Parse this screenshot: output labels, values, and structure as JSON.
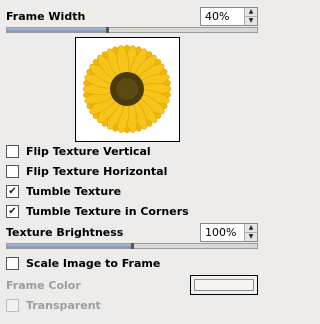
{
  "frame_width": {
    "label": "Frame Width",
    "value": "40%",
    "level": 0.4
  },
  "preview": {
    "icon": "sunflower-icon"
  },
  "options": [
    {
      "label": "Flip Texture Vertical",
      "checked": false
    },
    {
      "label": "Flip Texture Horizontal",
      "checked": false
    },
    {
      "label": "Tumble Texture",
      "checked": true
    },
    {
      "label": "Tumble Texture in Corners",
      "checked": true
    }
  ],
  "texture_brightness": {
    "label": "Texture Brightness",
    "value": "100%",
    "level": 0.5
  },
  "scale_image": {
    "label": "Scale Image to Frame",
    "checked": false
  },
  "frame_color": {
    "label": "Frame Color"
  },
  "transparent": {
    "label": "Transparent",
    "checked": false
  },
  "colors": {
    "slider_fill": "#7a92bd",
    "petal": "#f2b705",
    "center": "#4a3b0a"
  }
}
